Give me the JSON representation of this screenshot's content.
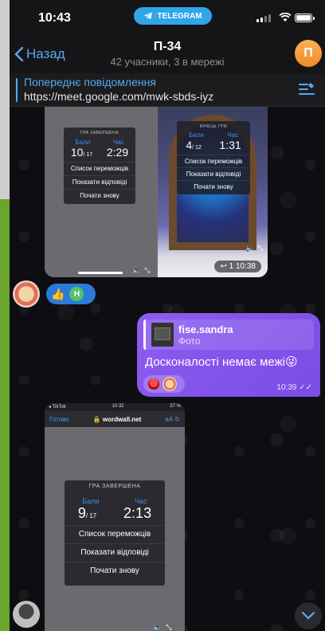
{
  "status_bar": {
    "time": "10:43",
    "telegram_label": "TELEGRAM"
  },
  "header": {
    "back_label": "Назад",
    "title": "П-34",
    "subtitle": "42 учасники, 3 в мережі",
    "avatar_letter": "П"
  },
  "pinned": {
    "title": "Попереднє повідомлення",
    "text": "https://meet.google.com/mwk-sbds-iyz"
  },
  "media1": {
    "left_card": {
      "heading": "ГРА ЗАВЕРШЕНА",
      "score_label": "Бали",
      "time_label": "Час",
      "score": "10",
      "score_total": "/ 17",
      "time": "2:29",
      "menu": [
        "Список переможців",
        "Показати відповіді",
        "Почати знову"
      ]
    },
    "right_card": {
      "heading": "КІНЕЦЬ ГРИ",
      "score_label": "Бали",
      "time_label": "Час",
      "score": "4",
      "score_total": "/ 12",
      "time": "1:31",
      "menu": [
        "Список переможців",
        "Показати відповіді",
        "Почати знову"
      ]
    },
    "time": "10:38",
    "reply_count": "1"
  },
  "reactions_row": {
    "thumb": "👍",
    "badge_letter": "Н"
  },
  "outgoing": {
    "reply_name": "fise.sandra",
    "reply_sub": "Фото",
    "text": "Досконалості немає межі😜",
    "time": "10:39"
  },
  "media2": {
    "status_left": "◂ TikTok",
    "status_time": "10:32",
    "status_right": "37 %",
    "done_label": "Готово",
    "url": "wordwall.net",
    "aa_label": "аА",
    "card": {
      "heading": "ГРА ЗАВЕРШЕНА",
      "score_label": "Бали",
      "time_label": "Час",
      "score": "9",
      "score_total": "/ 17",
      "time": "2:13",
      "menu": [
        "Список переможців",
        "Показати відповіді",
        "Почати знову"
      ]
    }
  },
  "colors": {
    "accent": "#5aa8f0",
    "outgoing_bubble": "#8e5cf0",
    "telegram_blue": "#2ea6e8",
    "group_avatar": "#f39a35"
  }
}
